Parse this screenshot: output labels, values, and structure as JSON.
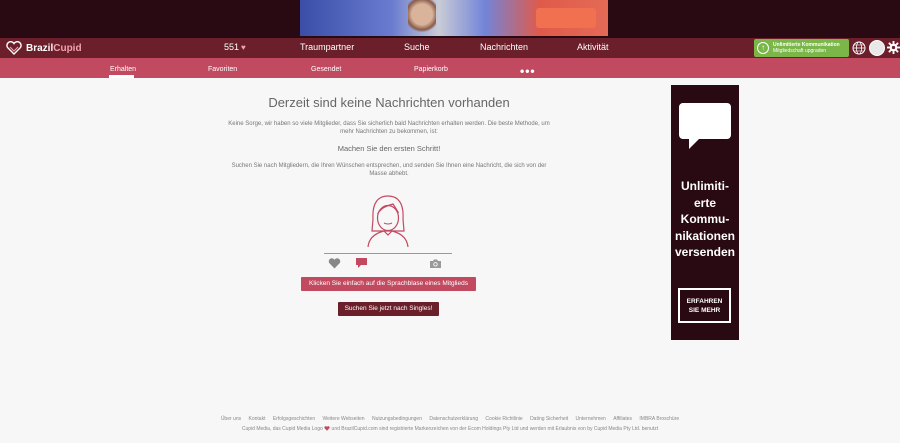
{
  "brand": {
    "name_part1": "Brazil",
    "name_part2": "Cupid"
  },
  "main_nav": {
    "count": "551",
    "items": [
      "Traumpartner",
      "Suche",
      "Nachrichten",
      "Aktivität"
    ]
  },
  "upgrade": {
    "title": "Unlimitierte Kommunikation",
    "subtitle": "Mitgliedschaft upgraden"
  },
  "sub_nav": {
    "items": [
      "Erhalten",
      "Favoriten",
      "Gesendet",
      "Papierkorb"
    ],
    "more": "•••",
    "active": "Erhalten"
  },
  "content": {
    "title": "Derzeit sind keine Nachrichten vorhanden",
    "para1": "Keine Sorge, wir haben so viele Mitglieder, dass Sie sicherlich bald Nachrichten erhalten werden. Die beste Methode, um mehr Nachrichten zu bekommen, ist:",
    "step": "Machen Sie den ersten Schritt!",
    "para2": "Suchen Sie nach Mitgliedern, die Ihren Wünschen entsprechen, und senden Sie Ihnen eine Nachricht, die sich von der Masse abhebt.",
    "cta_bubble": "Klicken Sie einfach auf die Sprachblase eines Mitglieds",
    "cta_search": "Suchen Sie jetzt nach Singles!"
  },
  "side_ad": {
    "lines": [
      "Unlimiti-",
      "erte",
      "Kommu-",
      "nikationen",
      "versenden"
    ],
    "button_line1": "ERFAHREN",
    "button_line2": "SIE MEHR"
  },
  "footer": {
    "links": [
      "Über uns",
      "Kontakt",
      "Erfolgsgeschichten",
      "Weitere Webseiten",
      "Nutzungsbedingungen",
      "Datenschutzerklärung",
      "Cookie Richtlinie",
      "Dating Sicherheit",
      "Unternehmen",
      "Affiliates",
      "IMBRA Broschüre"
    ],
    "copyright_part1": "Cupid Media, das Cupid Media Logo",
    "copyright_part2": "und BrazilCupid.com sind registrierte Markenzeichen von der Ecom Holdings Pty Ltd und werden mit Erlaubnis von by Cupid Media Pty Ltd. benutzt"
  },
  "colors": {
    "topband": "#2a0a12",
    "nav": "#6b1f2b",
    "subnav": "#c24a60",
    "upgrade": "#7ab648",
    "page": "#f7f7f7"
  }
}
